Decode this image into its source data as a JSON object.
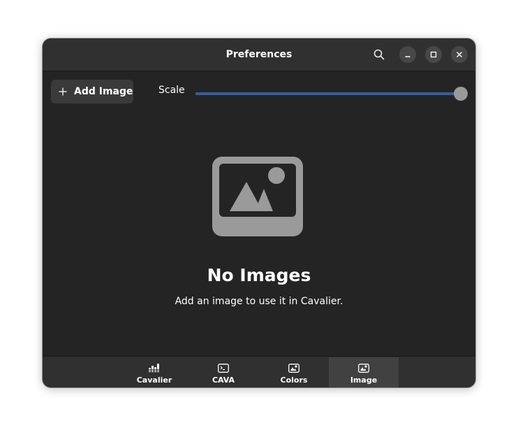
{
  "window": {
    "title": "Preferences"
  },
  "toolbar": {
    "add_image_label": "Add Image",
    "scale_label": "Scale",
    "scale_value": 1.0
  },
  "empty_state": {
    "title": "No Images",
    "description": "Add an image to use it in Cavalier."
  },
  "tabs": [
    {
      "label": "Cavalier",
      "icon": "equalizer-icon",
      "active": false
    },
    {
      "label": "CAVA",
      "icon": "terminal-icon",
      "active": false
    },
    {
      "label": "Colors",
      "icon": "image-icon",
      "active": false
    },
    {
      "label": "Image",
      "icon": "image-icon",
      "active": true
    }
  ],
  "colors": {
    "accent": "#3d5d94",
    "window_bg": "#242424",
    "headerbar_bg": "#303030"
  }
}
